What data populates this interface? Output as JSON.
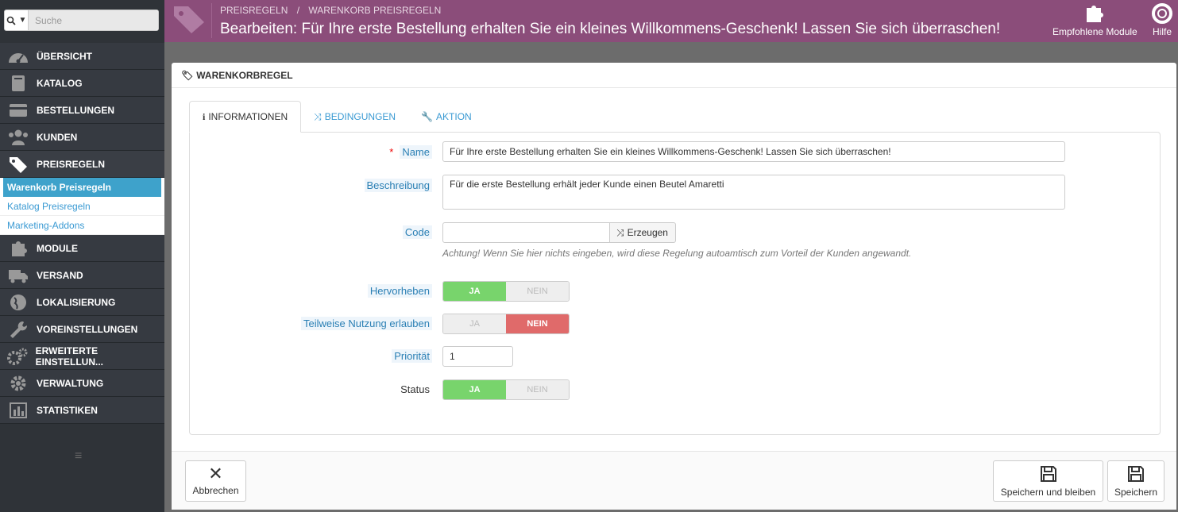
{
  "search": {
    "placeholder": "Suche"
  },
  "sidebar": {
    "items": [
      {
        "label": "ÜBERSICHT",
        "icon": "dashboard-icon"
      },
      {
        "label": "KATALOG",
        "icon": "book-icon"
      },
      {
        "label": "BESTELLUNGEN",
        "icon": "credit-card-icon"
      },
      {
        "label": "KUNDEN",
        "icon": "users-icon"
      },
      {
        "label": "PREISREGELN",
        "icon": "tags-icon"
      },
      {
        "label": "MODULE",
        "icon": "puzzle-icon"
      },
      {
        "label": "VERSAND",
        "icon": "truck-icon"
      },
      {
        "label": "LOKALISIERUNG",
        "icon": "globe-icon"
      },
      {
        "label": "VOREINSTELLUNGEN",
        "icon": "wrench-icon"
      },
      {
        "label": "ERWEITERTE EINSTELLUN...",
        "icon": "cogs-icon"
      },
      {
        "label": "VERWALTUNG",
        "icon": "gear-icon"
      },
      {
        "label": "STATISTIKEN",
        "icon": "bar-chart-icon"
      }
    ],
    "sub": [
      "Warenkorb Preisregeln",
      "Katalog Preisregeln",
      "Marketing-Addons"
    ]
  },
  "header": {
    "breadcrumb": [
      "PREISREGELN",
      "/",
      "WARENKORB PREISREGELN"
    ],
    "title": "Bearbeiten: Für Ihre erste Bestellung erhalten Sie ein kleines Willkommens-Geschenk! Lassen Sie sich überraschen!",
    "btn_modules": "Empfohlene Module",
    "btn_help": "Hilfe"
  },
  "panel": {
    "title": "WARENKORBREGEL",
    "tabs": [
      "INFORMATIONEN",
      "BEDINGUNGEN",
      "AKTION"
    ]
  },
  "form": {
    "name_label": "Name",
    "name_value": "Für Ihre erste Bestellung erhalten Sie ein kleines Willkommens-Geschenk! Lassen Sie sich überraschen!",
    "desc_label": "Beschreibung",
    "desc_value": "Für die erste Bestellung erhält jeder Kunde einen Beutel Amaretti",
    "code_label": "Code",
    "code_value": "",
    "generate_label": "Erzeugen",
    "code_hint": "Achtung! Wenn Sie hier nichts eingeben, wird diese Regelung autoamtisch zum Vorteil der Kunden angewandt.",
    "highlight_label": "Hervorheben",
    "partial_label": "Teilweise Nutzung erlauben",
    "priority_label": "Priorität",
    "priority_value": "1",
    "status_label": "Status",
    "yes": "JA",
    "no": "NEIN"
  },
  "footer": {
    "cancel": "Abbrechen",
    "save_stay": "Speichern und bleiben",
    "save": "Speichern"
  }
}
